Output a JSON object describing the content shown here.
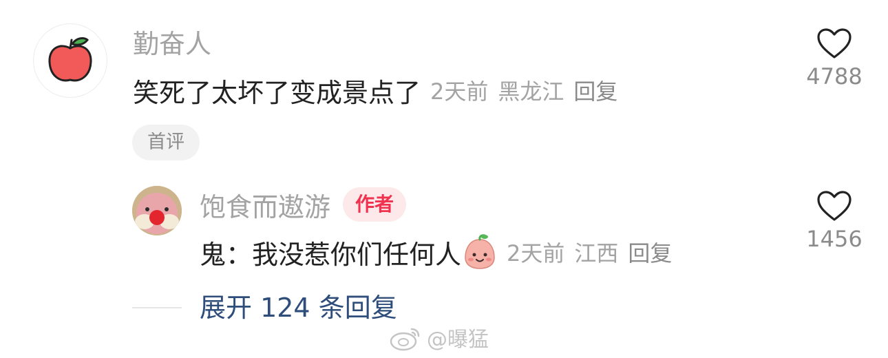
{
  "top_comment": {
    "author": "勤奋人",
    "text": "笑死了太坏了变成景点了",
    "time": "2天前",
    "location": "黑龙江",
    "reply_label": "回复",
    "badge": "首评",
    "likes": "4788",
    "avatar_icon": "apple-icon",
    "liked": false
  },
  "reply_comment": {
    "author": "饱食而遨游",
    "author_tag": "作者",
    "text": "鬼：我没惹你们任何人",
    "emoji_icon": "peach-face-icon",
    "time": "2天前",
    "location": "江西",
    "reply_label": "回复",
    "likes": "1456",
    "liked": false
  },
  "expand": {
    "label": "展开 124 条回复"
  },
  "watermark": {
    "text": "@曝猛",
    "icon": "weibo-logo-icon"
  },
  "colors": {
    "author_tag_text": "#f0324f",
    "author_tag_bg": "#fde8ea",
    "expand_link": "#2e4d7a",
    "meta_gray": "#a3a3a3"
  }
}
